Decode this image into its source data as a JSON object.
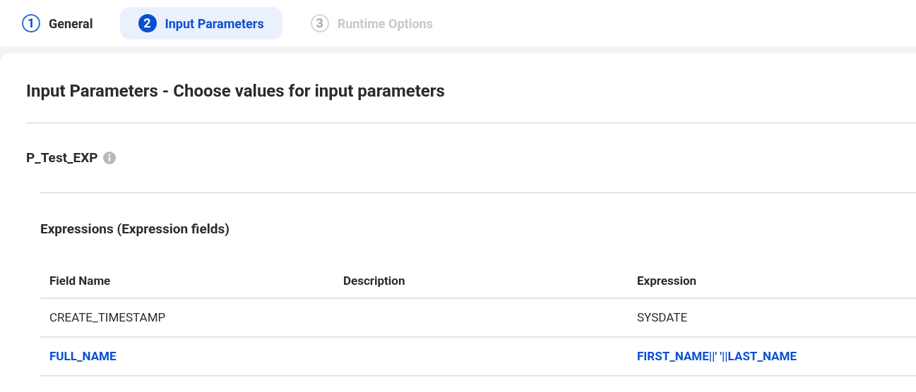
{
  "steps": [
    {
      "number": "1",
      "label": "General",
      "selected": false,
      "disabled": false
    },
    {
      "number": "2",
      "label": "Input Parameters",
      "selected": true,
      "disabled": false
    },
    {
      "number": "3",
      "label": "Runtime Options",
      "selected": false,
      "disabled": true
    }
  ],
  "title": "Input Parameters - Choose values for input parameters",
  "parameter": {
    "name": "P_Test_EXP"
  },
  "section": {
    "title": "Expressions (Expression fields)"
  },
  "table": {
    "columns": [
      "Field Name",
      "Description",
      "Expression"
    ],
    "rows": [
      {
        "cells": [
          "CREATE_TIMESTAMP",
          "",
          "SYSDATE"
        ],
        "selected": false
      },
      {
        "cells": [
          "FULL_NAME",
          "",
          "FIRST_NAME||' '||LAST_NAME"
        ],
        "selected": true
      }
    ]
  }
}
